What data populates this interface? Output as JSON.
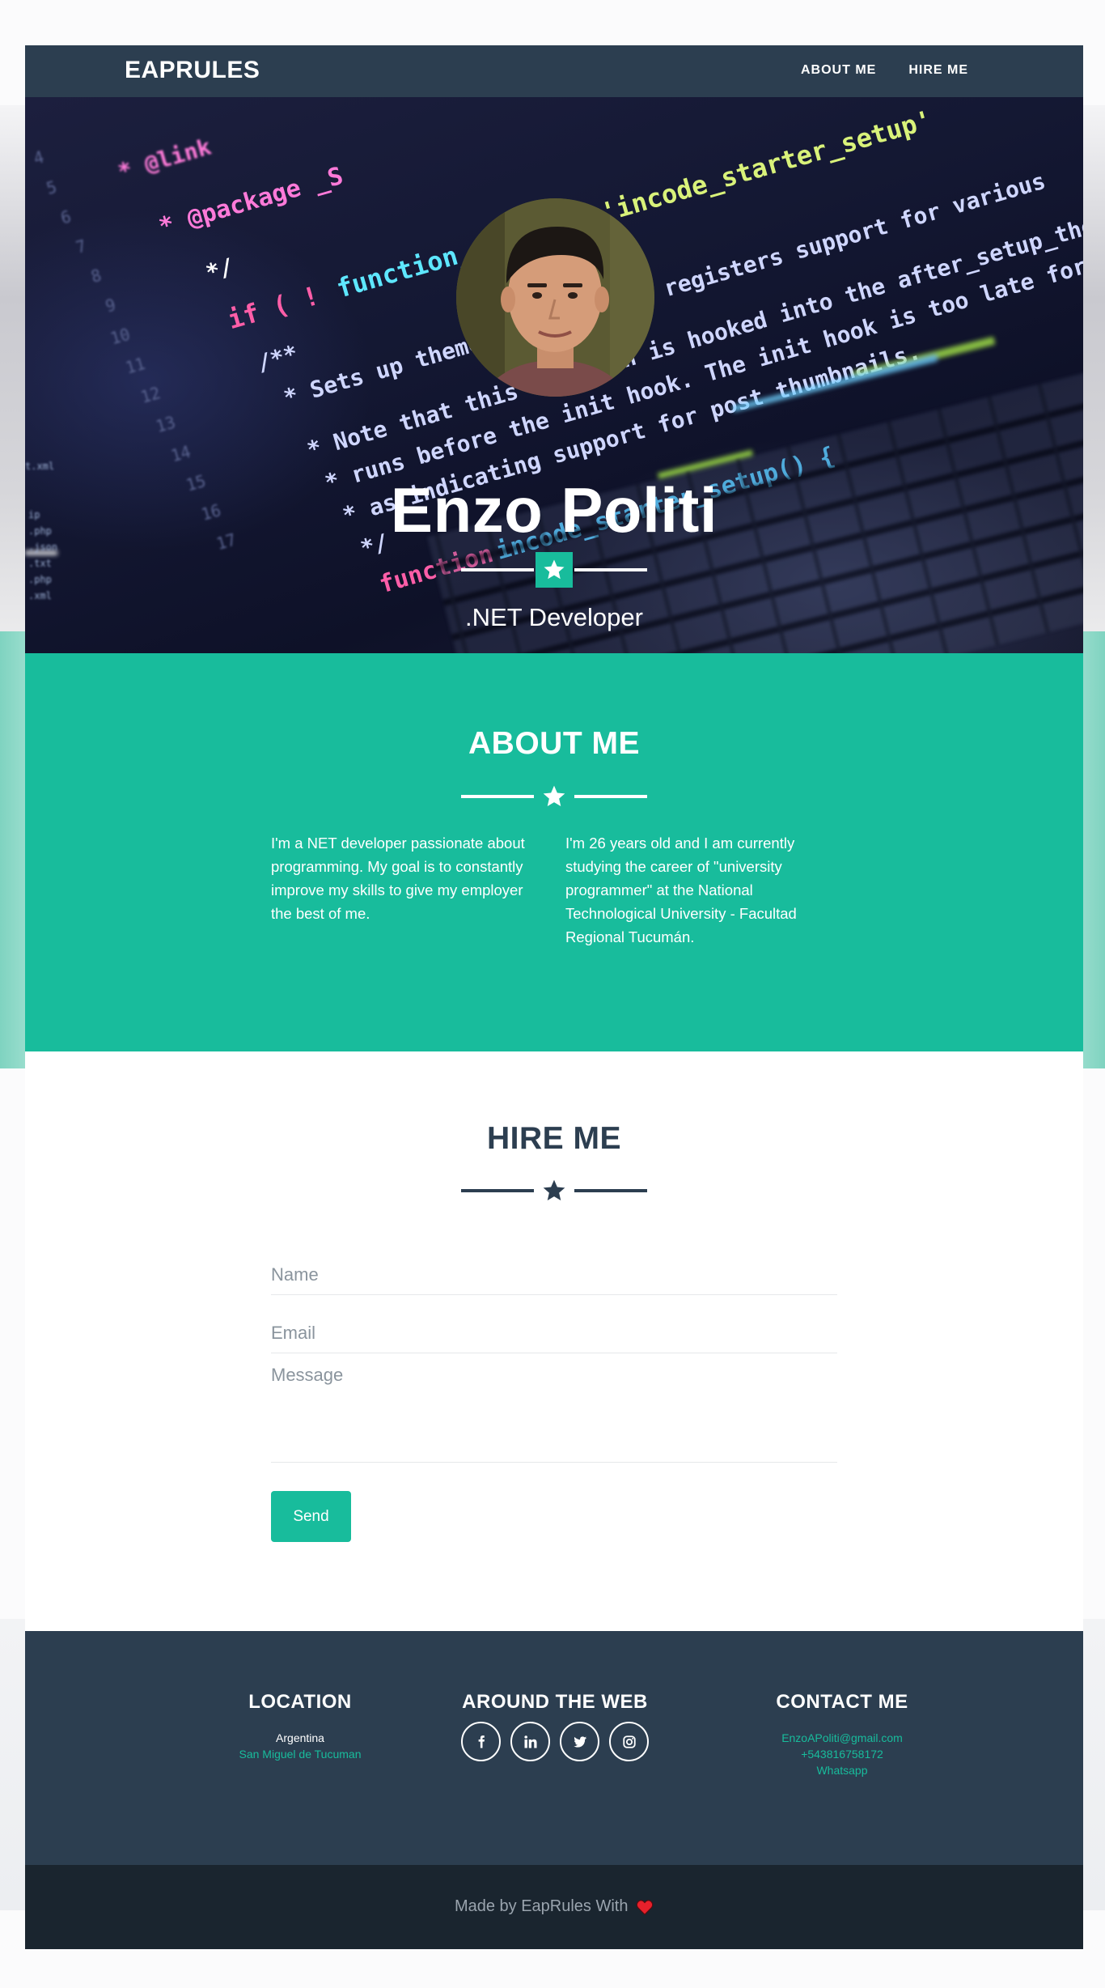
{
  "navbar": {
    "brand": "EAPRULES",
    "links": [
      "ABOUT ME",
      "HIRE ME"
    ]
  },
  "hero": {
    "name": "Enzo Politi",
    "role": ".NET Developer"
  },
  "about": {
    "title": "ABOUT ME",
    "paragraph_left": "I'm a NET developer passionate about programming. My goal is to constantly improve my skills to give my employer the best of me.",
    "paragraph_right": "I'm  26 years old and I am currently studying the career of \"university programmer\" at the National Technological University - Facultad Regional Tucumán."
  },
  "hire": {
    "title": "HIRE ME",
    "name_placeholder": "Name",
    "email_placeholder": "Email",
    "message_placeholder": "Message",
    "send_label": "Send"
  },
  "footer": {
    "location_title": "LOCATION",
    "country": "Argentina",
    "city": "San Miguel de Tucuman",
    "web_title": "AROUND THE WEB",
    "social_icons": [
      "facebook-icon",
      "linkedin-icon",
      "twitter-icon",
      "instagram-icon"
    ],
    "contact_title": "CONTACT ME",
    "email": "EnzoAPoliti@gmail.com",
    "phone": "+543816758172",
    "whatsapp": "Whatsapp"
  },
  "copyright": {
    "text": "Made by EapRules With"
  },
  "colors": {
    "primary": "#2c3e50",
    "accent": "#18bc9c",
    "dark": "#1a252f",
    "heart": "#e7202b"
  }
}
